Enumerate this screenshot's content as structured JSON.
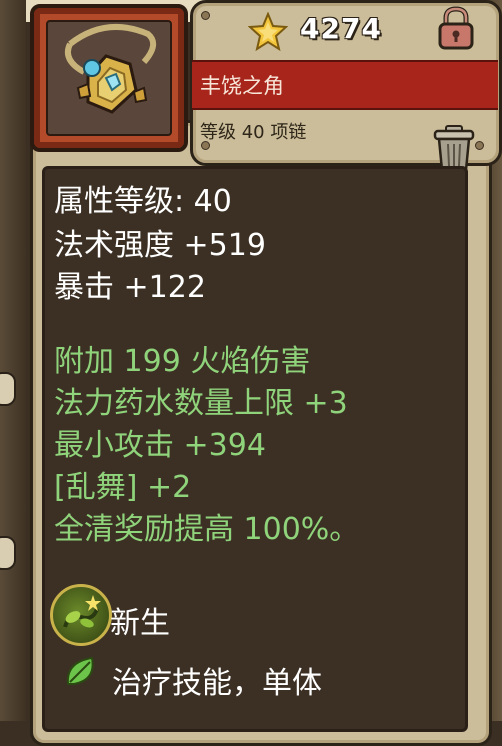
{
  "item": {
    "price": "4274",
    "name": "丰饶之角",
    "subtitle": "等级 40 项链"
  },
  "stats": [
    {
      "text": "属性等级: 40",
      "color": "white"
    },
    {
      "text": "法术强度 +519",
      "color": "white"
    },
    {
      "text": "暴击 +122",
      "color": "white"
    }
  ],
  "bonuses": [
    {
      "text": "附加 199 火焰伤害",
      "color": "green"
    },
    {
      "text": "法力药水数量上限 +3",
      "color": "green"
    },
    {
      "text": "最小攻击 +394",
      "color": "green"
    },
    {
      "text": "[乱舞] +2",
      "color": "green"
    },
    {
      "text": "全清奖励提高 100%。",
      "color": "green"
    }
  ],
  "skill": {
    "name": "新生",
    "description": "治疗技能，单体"
  },
  "colors": {
    "stat_text": "#ffffff",
    "bonus_text": "#8fd37b",
    "name_band": "#a8251c",
    "panel_bg": "#3c3024"
  },
  "icons": [
    "necklace-icon",
    "star-coin-icon",
    "lock-icon",
    "trash-icon",
    "skill-rebirth-icon",
    "leaf-icon"
  ]
}
